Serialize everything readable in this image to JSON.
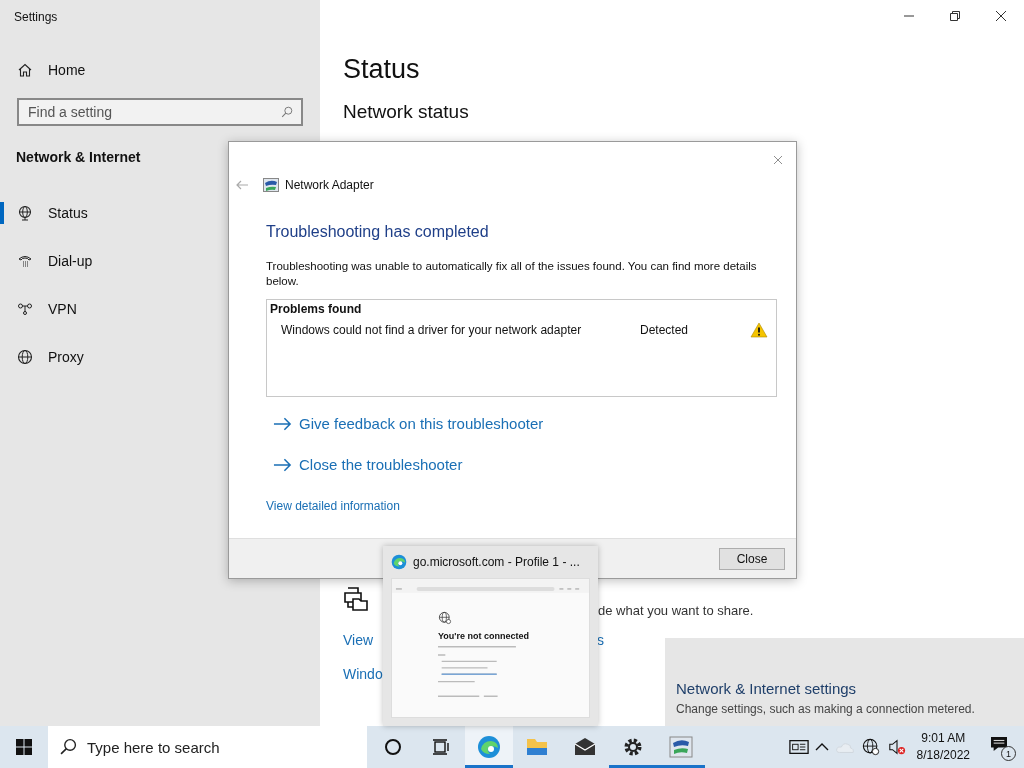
{
  "window": {
    "title": "Settings"
  },
  "sidebar": {
    "home": "Home",
    "search": {
      "placeholder": "Find a setting"
    },
    "section": "Network & Internet",
    "items": [
      {
        "label": "Status",
        "selected": true
      },
      {
        "label": "Dial-up",
        "selected": false
      },
      {
        "label": "VPN",
        "selected": false
      },
      {
        "label": "Proxy",
        "selected": false
      }
    ]
  },
  "main": {
    "title": "Status",
    "subtitle": "Network status",
    "share_row": {
      "description_right": "de what you want to share."
    },
    "links": [
      {
        "left": "View",
        "right": "s"
      },
      {
        "left": "Windo"
      }
    ]
  },
  "dialog": {
    "app_title": "Network Adapter",
    "heading": "Troubleshooting has completed",
    "message": "Troubleshooting was unable to automatically fix all of the issues found. You can find more details below.",
    "problems": {
      "header": "Problems found",
      "rows": [
        {
          "issue": "Windows could not find a driver for your network adapter",
          "status": "Detected"
        }
      ]
    },
    "actions": [
      "Give feedback on this troubleshooter",
      "Close the troubleshooter"
    ],
    "details_link": "View detailed information",
    "close_button": "Close"
  },
  "preview": {
    "title": "go.microsoft.com - Profile 1 - ...",
    "page_heading": "You're not connected"
  },
  "related_panel": {
    "title": "Network & Internet settings",
    "description": "Change settings, such as making a connection metered."
  },
  "taskbar": {
    "search": {
      "placeholder": "Type here to search"
    },
    "apps": [
      {
        "running": true,
        "selected": true
      },
      {
        "running": false,
        "selected": false
      },
      {
        "running": false,
        "selected": false
      },
      {
        "running": true,
        "selected": false
      },
      {
        "running": true,
        "selected": false
      }
    ],
    "clock": {
      "time": "9:01 AM",
      "date": "8/18/2022"
    },
    "notification_count": "1"
  }
}
